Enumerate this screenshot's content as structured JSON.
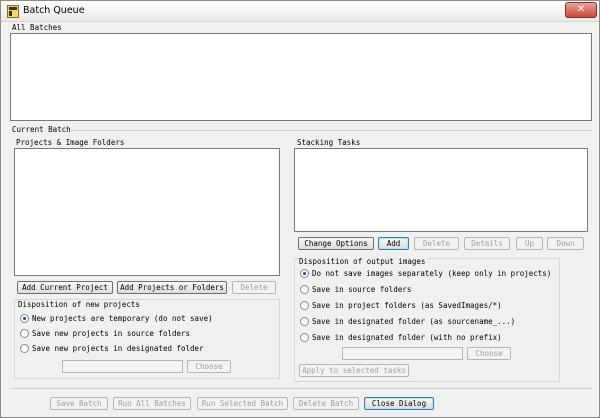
{
  "window": {
    "title": "Batch Queue",
    "close_glyph": "✕"
  },
  "all_batches": {
    "label": "All Batches"
  },
  "current_batch": {
    "label": "Current Batch"
  },
  "projects": {
    "label": "Projects & Image Folders",
    "buttons": {
      "add_current": "Add Current Project",
      "add_folders": "Add Projects or Folders",
      "delete": "Delete"
    }
  },
  "new_projects": {
    "label": "Disposition of new projects",
    "options": [
      {
        "label": "New projects are temporary (do not save)",
        "checked": true
      },
      {
        "label": "Save new projects in source folders",
        "checked": false
      },
      {
        "label": "Save new projects in designated folder",
        "checked": false
      }
    ],
    "choose": "Choose"
  },
  "stacking": {
    "label": "Stacking Tasks",
    "buttons": {
      "change": "Change Options",
      "add": "Add",
      "delete": "Delete",
      "details": "Details",
      "up": "Up",
      "down": "Down"
    }
  },
  "output": {
    "label": "Disposition of output images",
    "options": [
      {
        "label": "Do not save images separately (keep only in projects)",
        "checked": true
      },
      {
        "label": "Save in source folders",
        "checked": false
      },
      {
        "label": "Save in project folders (as SavedImages/*)",
        "checked": false
      },
      {
        "label": "Save in designated folder (as sourcename_...)",
        "checked": false
      },
      {
        "label": "Save in designated folder (with no prefix)",
        "checked": false
      }
    ],
    "choose": "Choose",
    "apply": "Apply to selected tasks"
  },
  "footer": {
    "save_batch": "Save Batch",
    "run_all": "Run All Batches",
    "run_selected": "Run Selected Batch",
    "delete_batch": "Delete Batch",
    "close_dialog": "Close Dialog"
  }
}
